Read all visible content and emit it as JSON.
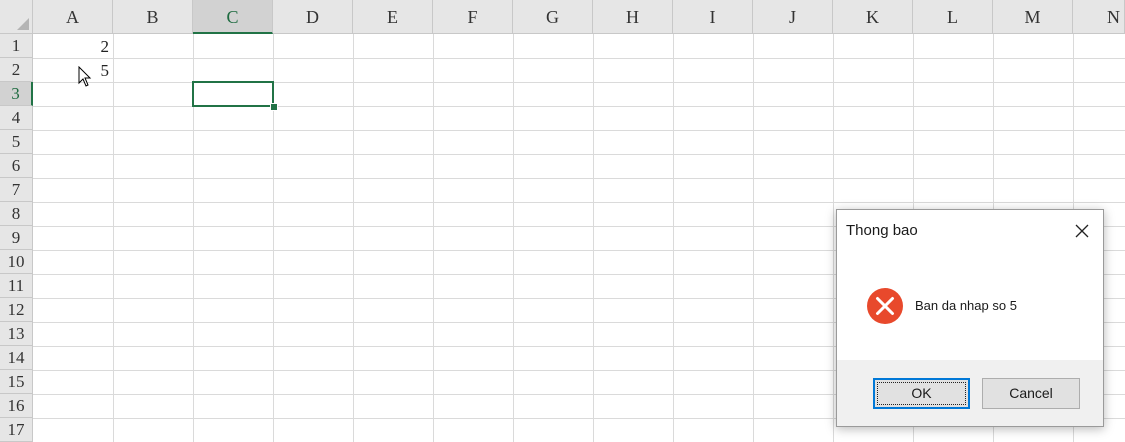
{
  "columns": [
    "A",
    "B",
    "C",
    "D",
    "E",
    "F",
    "G",
    "H",
    "I",
    "J",
    "K",
    "L",
    "M",
    "N"
  ],
  "rows": [
    "1",
    "2",
    "3",
    "4",
    "5",
    "6",
    "7",
    "8",
    "9",
    "10",
    "11",
    "12",
    "13",
    "14",
    "15",
    "16",
    "17"
  ],
  "selected_column": "C",
  "selected_row": "3",
  "cells": {
    "A1": "2",
    "A2": "5"
  },
  "dialog": {
    "title": "Thong bao",
    "message": "Ban da nhap so 5",
    "ok_label": "OK",
    "cancel_label": "Cancel",
    "icon": "error-icon",
    "close_icon": "close-icon"
  },
  "colors": {
    "selection_green": "#217346",
    "error_red": "#e8492c",
    "ok_border": "#0078d7"
  }
}
